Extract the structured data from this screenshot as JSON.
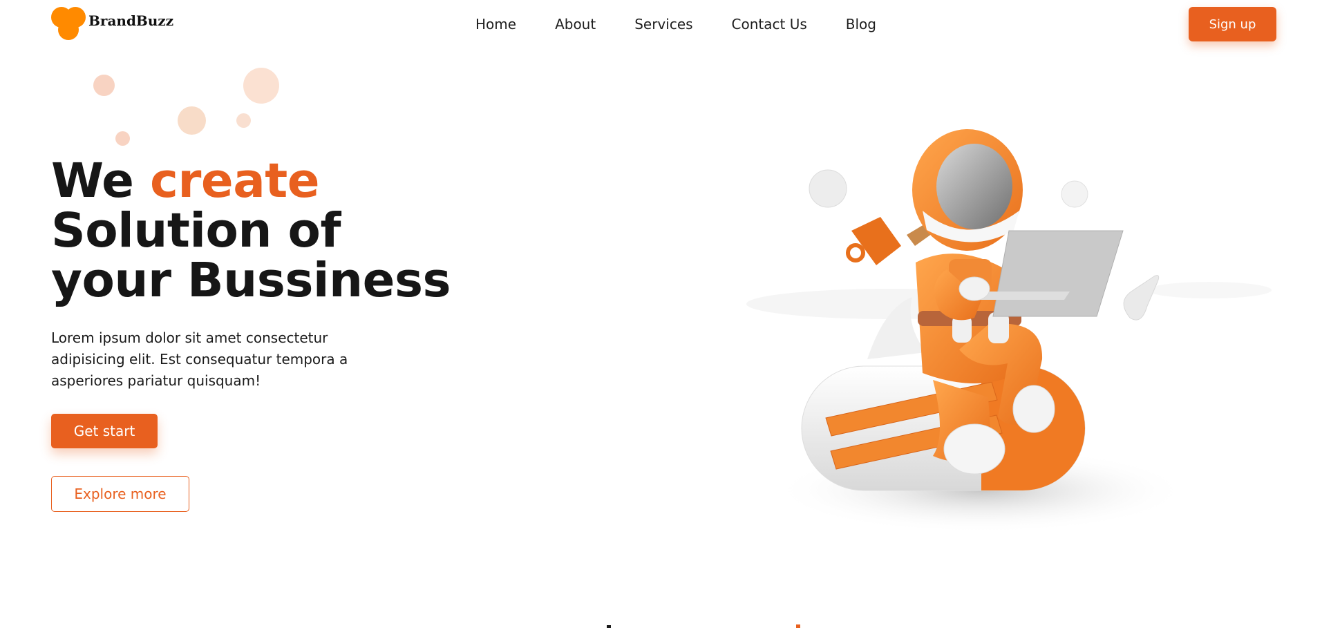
{
  "brand": {
    "name": "BrandBuzz",
    "color": "#ff8a00"
  },
  "nav": {
    "items": [
      {
        "label": "Home"
      },
      {
        "label": "About"
      },
      {
        "label": "Services"
      },
      {
        "label": "Contact Us"
      },
      {
        "label": "Blog"
      }
    ]
  },
  "header": {
    "signup_label": "Sign up"
  },
  "hero": {
    "headline_part1": "We ",
    "headline_accent": "create",
    "headline_line2": "Solution of",
    "headline_line3": "your Bussiness",
    "description": "Lorem ipsum dolor sit amet consectetur adipisicing elit. Est consequatur tempora a asperiores pariatur quisquam!",
    "primary_cta": "Get start",
    "secondary_cta": "Explore more"
  },
  "theme": {
    "accent": "#e8601f",
    "text": "#161616",
    "background": "#ffffff"
  },
  "icons": [
    "logo-icon",
    "astronaut-illustration",
    "decorative-bubble"
  ]
}
